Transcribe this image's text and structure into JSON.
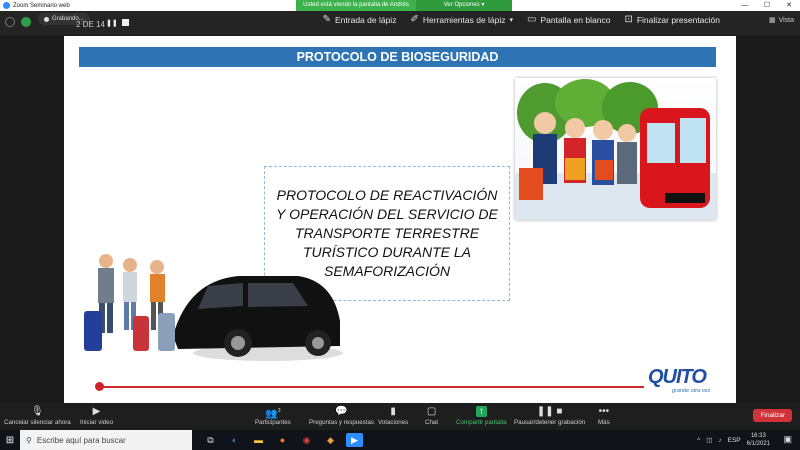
{
  "window": {
    "title": "Zoom Seminario web",
    "controls": [
      "—",
      "☐",
      "✕"
    ]
  },
  "share_banner": {
    "text": "Usted está viendo la pantalla de Andrés Dueñas",
    "options_label": "Ver Opciones ▾"
  },
  "recording": {
    "label": "Grabando..."
  },
  "slide_page": {
    "label": "2 DE 14"
  },
  "annotation_tools": [
    {
      "label": "Entrada de lápiz",
      "icon": "pen-icon"
    },
    {
      "label": "Herramientas de lápiz",
      "icon": "pen-tools-icon"
    },
    {
      "label": "Pantalla en blanco",
      "icon": "blank-screen-icon"
    },
    {
      "label": "Finalizar presentación",
      "icon": "end-presentation-icon"
    }
  ],
  "view_button": {
    "label": "Vista"
  },
  "slide": {
    "header": "PROTOCOLO DE BIOSEGURIDAD",
    "body_text": "PROTOCOLO DE REACTIVACIÓN Y OPERACIÓN DEL SERVICIO DE TRANSPORTE TERRESTRE TURÍSTICO DURANTE LA SEMAFORIZACIÓN",
    "logo_text": "QUITO",
    "logo_tagline": "grande otra vez",
    "accent_color": "#2e74b5",
    "line_color": "#d02a2a"
  },
  "meeting_controls": {
    "mute_label": "Cancelar silenciar ahora",
    "video_label": "Iniciar video",
    "participants_label": "Participantes",
    "participants_count": "3",
    "qa_label": "Preguntas y respuestas",
    "polls_label": "Votaciones",
    "chat_label": "Chat",
    "share_label": "Compartir pantalla",
    "record_label": "Pausar/detener grabación",
    "more_label": "Más",
    "end_label": "Finalizar"
  },
  "taskbar": {
    "search_placeholder": "Escribe aquí para buscar",
    "language": "ESP",
    "time": "16:33",
    "date": "6/1/2021"
  }
}
